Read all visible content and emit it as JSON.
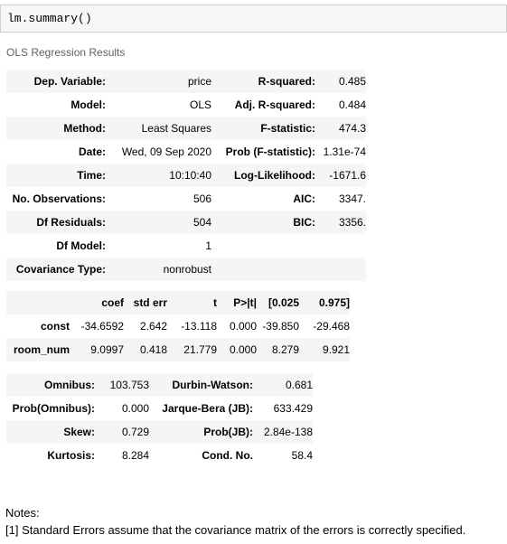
{
  "code_cell": {
    "code": "lm.summary()"
  },
  "output": {
    "title": "OLS Regression Results",
    "table1": [
      [
        "Dep. Variable:",
        "price",
        "R-squared:",
        "0.485"
      ],
      [
        "Model:",
        "OLS",
        "Adj. R-squared:",
        "0.484"
      ],
      [
        "Method:",
        "Least Squares",
        "F-statistic:",
        "474.3"
      ],
      [
        "Date:",
        "Wed, 09 Sep 2020",
        "Prob (F-statistic):",
        "1.31e-74"
      ],
      [
        "Time:",
        "10:10:40",
        "Log-Likelihood:",
        "-1671.6"
      ],
      [
        "No. Observations:",
        "506",
        "AIC:",
        "3347."
      ],
      [
        "Df Residuals:",
        "504",
        "BIC:",
        "3356."
      ],
      [
        "Df Model:",
        "1",
        "",
        ""
      ],
      [
        "Covariance Type:",
        "nonrobust",
        "",
        ""
      ]
    ],
    "table2": {
      "headers": [
        "",
        "coef",
        "std err",
        "t",
        "P>|t|",
        "[0.025",
        "0.975]"
      ],
      "rows": [
        [
          "const",
          "-34.6592",
          "2.642",
          "-13.118",
          "0.000",
          "-39.850",
          "-29.468"
        ],
        [
          "room_num",
          "9.0997",
          "0.418",
          "21.779",
          "0.000",
          "8.279",
          "9.921"
        ]
      ]
    },
    "table3": [
      [
        "Omnibus:",
        "103.753",
        "Durbin-Watson:",
        "0.681"
      ],
      [
        "Prob(Omnibus):",
        "0.000",
        "Jarque-Bera (JB):",
        "633.429"
      ],
      [
        "Skew:",
        "0.729",
        "Prob(JB):",
        "2.84e-138"
      ],
      [
        "Kurtosis:",
        "8.284",
        "Cond. No.",
        "58.4"
      ]
    ],
    "notes_title": "Notes:",
    "notes": [
      "[1] Standard Errors assume that the covariance matrix of the errors is correctly specified."
    ]
  }
}
